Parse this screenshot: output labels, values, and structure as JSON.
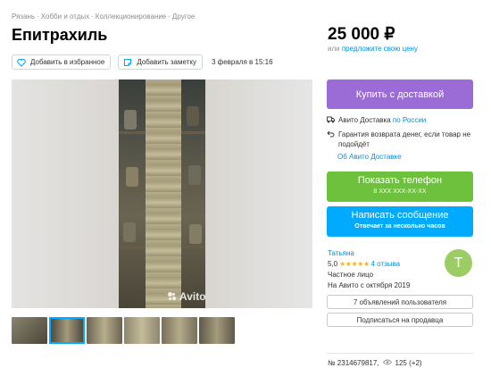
{
  "breadcrumb": [
    "Рязань",
    "Хобби и отдых",
    "Коллекционирование",
    "Другое"
  ],
  "title": "Епитрахиль",
  "actions": {
    "favorite_label": "Добавить в избранное",
    "note_label": "Добавить заметку",
    "date": "3 февраля в 15:16"
  },
  "gallery": {
    "watermark": "Avito",
    "thumbnail_count": 6
  },
  "price": {
    "value": "25 000 ₽",
    "note_prefix": "или",
    "note_link": "предложите свою цену"
  },
  "buy_button_label": "Купить с доставкой",
  "delivery": {
    "avito_label": "Авито Доставка",
    "avito_link": "по России",
    "refund_text": "Гарантия возврата денег, если товар не подойдёт",
    "about_link": "Об Авито Доставке"
  },
  "phone_button": {
    "label": "Показать телефон",
    "number": "8 XXX XXX-XX-XX"
  },
  "message_button": {
    "label": "Написать сообщение",
    "sub": "Отвечает за несколько часов"
  },
  "seller": {
    "name": "Татьяна",
    "rating": "5,0",
    "stars": "★★★★★",
    "reviews": "4 отзыва",
    "type": "Частное лицо",
    "since": "На Авито с октября 2019",
    "avatar_letter": "Т"
  },
  "seller_ads_label": "7 объявлений пользователя",
  "subscribe_label": "Подписаться на продавца",
  "meta": {
    "ad_number": "№ 2314679817,",
    "views": "125 (+2)"
  },
  "colors": {
    "buy": "#9c6cd6",
    "phone": "#6ec13d",
    "message": "#00aaff",
    "link": "#0091d9"
  }
}
